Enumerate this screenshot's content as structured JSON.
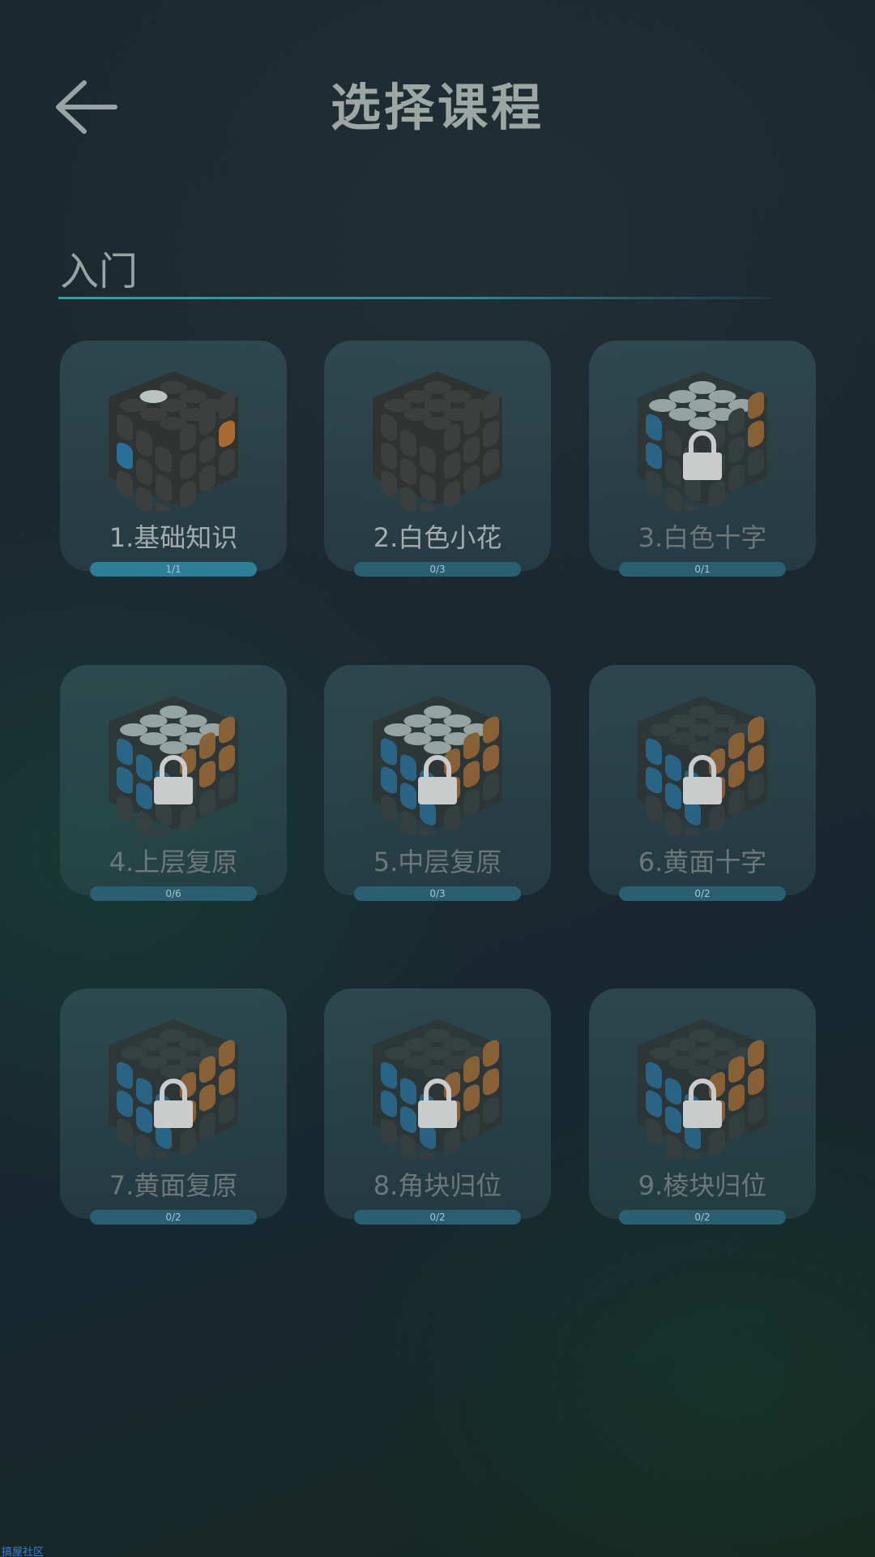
{
  "header": {
    "title": "选择课程",
    "back_icon": "arrow-left-icon"
  },
  "section": {
    "title": "入门"
  },
  "courses": [
    {
      "label": "1.基础知识",
      "progress": "1/1",
      "fraction": 1.0,
      "locked": false
    },
    {
      "label": "2.白色小花",
      "progress": "0/3",
      "fraction": 0.0,
      "locked": false
    },
    {
      "label": "3.白色十字",
      "progress": "0/1",
      "fraction": 0.0,
      "locked": true
    },
    {
      "label": "4.上层复原",
      "progress": "0/6",
      "fraction": 0.0,
      "locked": true
    },
    {
      "label": "5.中层复原",
      "progress": "0/3",
      "fraction": 0.0,
      "locked": true
    },
    {
      "label": "6.黄面十字",
      "progress": "0/2",
      "fraction": 0.0,
      "locked": true
    },
    {
      "label": "7.黄面复原",
      "progress": "0/2",
      "fraction": 0.0,
      "locked": true
    },
    {
      "label": "8.角块归位",
      "progress": "0/2",
      "fraction": 0.0,
      "locked": true
    },
    {
      "label": "9.棱块归位",
      "progress": "0/2",
      "fraction": 0.0,
      "locked": true
    }
  ],
  "colors": {
    "accent": "#2fa3a3",
    "progress_track": "#2a5f72",
    "progress_fill": "#2d7f98",
    "cube_white": "#b9c4c0",
    "cube_blue": "#2a6f9a",
    "cube_orange": "#a86a30",
    "cube_yellow": "#9aa83a",
    "cube_dark": "#3b3f3e"
  },
  "watermark": "搞屋社区"
}
